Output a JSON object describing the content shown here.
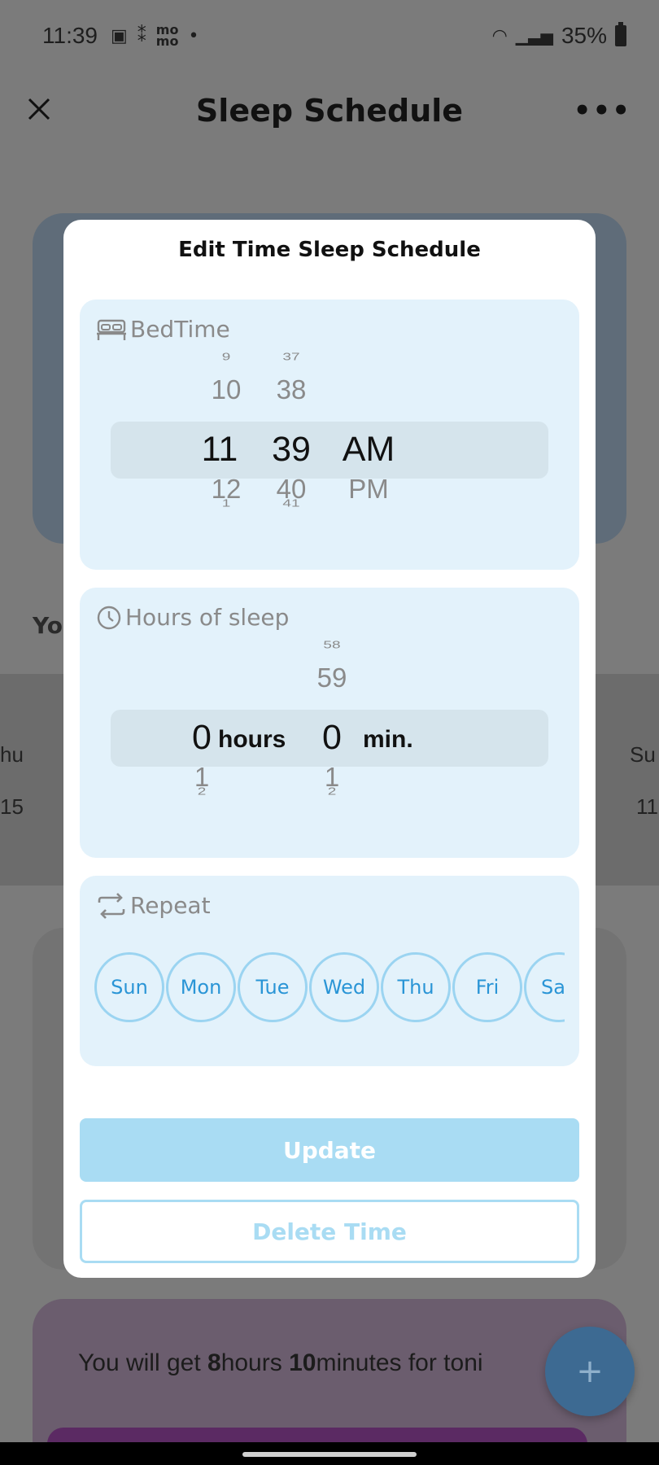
{
  "status_bar": {
    "time": "11:39",
    "battery": "35%",
    "left_icons": [
      "gallery-icon",
      "footprints-icon",
      "mo-icon",
      "dot-icon"
    ],
    "right_icons": [
      "wifi-icon",
      "signal-icon",
      "battery-icon"
    ]
  },
  "header": {
    "title": "Sleep Schedule",
    "more_label": "•••"
  },
  "background": {
    "section_label": "Yo",
    "days_left": [
      "hu",
      "15"
    ],
    "days_right": [
      "Su",
      "11"
    ],
    "summary_prefix": "You will get ",
    "summary_hours": "8",
    "summary_hours_label": "hours ",
    "summary_minutes": "10",
    "summary_minutes_label": "minutes for toni",
    "fab_label": "+"
  },
  "dialog": {
    "title": "Edit Time Sleep Schedule",
    "bedtime": {
      "label": "BedTime",
      "hours": {
        "far_above": "9",
        "above": "10",
        "selected": "11",
        "below": "12",
        "far_below": "1"
      },
      "minutes": {
        "far_above": "37",
        "above": "38",
        "selected": "39",
        "below": "40",
        "far_below": "41"
      },
      "period": {
        "selected": "AM",
        "below": "PM"
      }
    },
    "hours_of_sleep": {
      "label": "Hours of sleep",
      "hours": {
        "selected": "0",
        "below": "1",
        "far_below": "2",
        "unit": "hours"
      },
      "minutes": {
        "far_above": "58",
        "above": "59",
        "selected": "0",
        "below": "1",
        "far_below": "2",
        "unit": "min."
      }
    },
    "repeat": {
      "label": "Repeat",
      "days": [
        "Sun",
        "Mon",
        "Tue",
        "Wed",
        "Thu",
        "Fri",
        "Sa"
      ]
    },
    "update_label": "Update",
    "delete_label": "Delete Time"
  },
  "colors": {
    "accent": "#a9dcf3",
    "chip_text": "#2a95d6",
    "panel_bg": "#e3f2fb",
    "selector_band": "#d5e4ec"
  }
}
